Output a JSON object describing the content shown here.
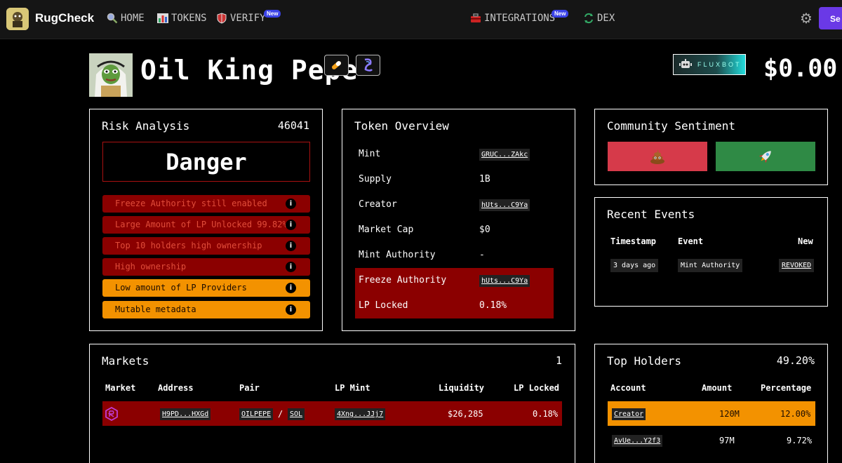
{
  "nav": {
    "brand": "RugCheck",
    "links": [
      {
        "label": "HOME",
        "icon": "magnifier-icon"
      },
      {
        "label": "TOKENS",
        "icon": "bar-chart-icon"
      },
      {
        "label": "VERIFY",
        "icon": "shield-icon",
        "badge": "New"
      },
      {
        "label": "INTEGRATIONS",
        "icon": "toolbox-icon",
        "badge": "New"
      },
      {
        "label": "DEX",
        "icon": "swap-icon"
      }
    ],
    "signin_label": "Se"
  },
  "header": {
    "token_name": "Oil King Pepe",
    "fluxbot_label": "FLUXBOT",
    "price": "$0.00"
  },
  "risk": {
    "title": "Risk Analysis",
    "score": "46041",
    "level": "Danger",
    "items": [
      {
        "label": "Freeze Authority still enabled",
        "severity": "danger"
      },
      {
        "label": "Large Amount of LP Unlocked 99.82%",
        "severity": "danger"
      },
      {
        "label": "Top 10 holders high ownership",
        "severity": "danger"
      },
      {
        "label": "High ownership",
        "severity": "danger"
      },
      {
        "label": "Low amount of LP Providers",
        "severity": "warn"
      },
      {
        "label": "Mutable metadata",
        "severity": "warn"
      }
    ]
  },
  "overview": {
    "title": "Token Overview",
    "rows": [
      {
        "label": "Mint",
        "value": "GRUC...ZAkc",
        "chip": true
      },
      {
        "label": "Supply",
        "value": "1B",
        "chip": false
      },
      {
        "label": "Creator",
        "value": "hUts...C9Ya",
        "chip": true
      },
      {
        "label": "Market Cap",
        "value": "$0",
        "chip": false
      },
      {
        "label": "Mint Authority",
        "value": "-",
        "chip": false
      },
      {
        "label": "Freeze Authority",
        "value": "hUts...C9Ya",
        "chip": true
      },
      {
        "label": "LP Locked",
        "value": "0.18%",
        "chip": false
      }
    ]
  },
  "sentiment": {
    "title": "Community Sentiment",
    "down_icon": "poop-icon",
    "up_icon": "rocket-icon"
  },
  "events": {
    "title": "Recent Events",
    "headers": [
      "Timestamp",
      "Event",
      "New"
    ],
    "rows": [
      {
        "timestamp": "3 days ago",
        "event": "Mint Authority",
        "new": "REVOKED"
      }
    ]
  },
  "markets": {
    "title": "Markets",
    "count": "1",
    "headers": [
      "Market",
      "Address",
      "Pair",
      "LP Mint",
      "Liquidity",
      "LP Locked"
    ],
    "rows": [
      {
        "address": "H9PD...HXGd",
        "pair_base": "OILPEPE",
        "pair_sep": "/",
        "pair_quote": "SOL",
        "lp_mint": "4Xng...JJj7",
        "liquidity": "$26,285",
        "lp_locked": "0.18%"
      }
    ]
  },
  "holders": {
    "title": "Top Holders",
    "total": "49.20%",
    "headers": [
      "Account",
      "Amount",
      "Percentage"
    ],
    "rows": [
      {
        "account": "Creator",
        "amount": "120M",
        "percentage": "12.00%"
      },
      {
        "account": "AvUe...Y2f3",
        "amount": "97M",
        "percentage": "9.72%"
      }
    ]
  },
  "colors": {
    "danger_bg": "#8b0000",
    "danger_text": "#e14d3a",
    "warn_bg": "#f39200",
    "accent_purple": "#6a39e6",
    "badge_blue": "#3b43e8",
    "vote_down": "#d63a4a",
    "vote_up": "#2f8a45"
  }
}
